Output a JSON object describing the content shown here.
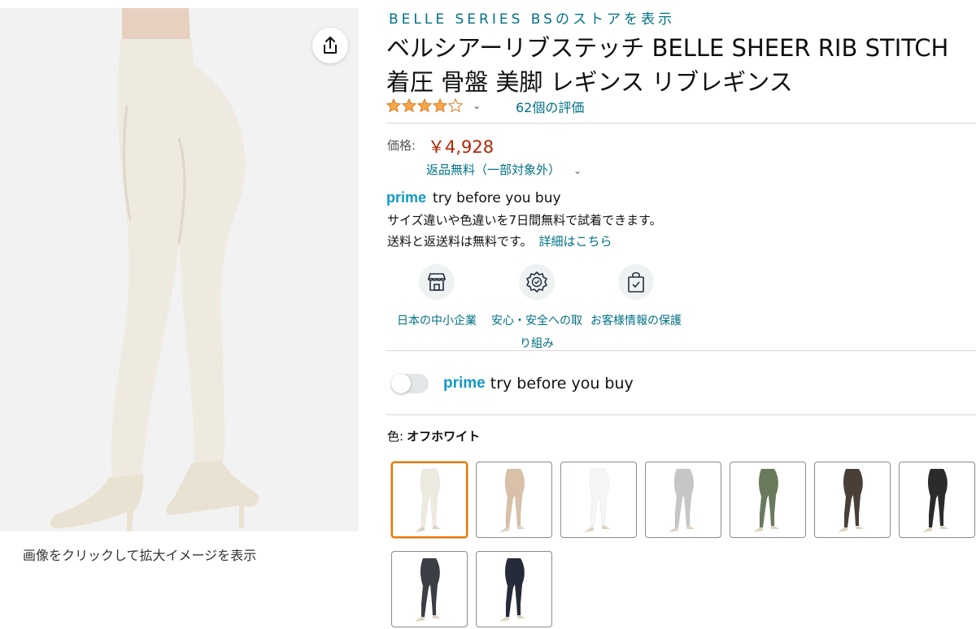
{
  "store_link": "BELLE SERIES BSのストアを表示",
  "title": "ベルシアーリブステッチ BELLE SHEER RIB STITCH 着圧 骨盤 美脚 レギンス リブレギンス",
  "rating": {
    "stars": 3.9,
    "count_text": "62個の評価"
  },
  "price": {
    "label": "価格:",
    "value": "￥4,928"
  },
  "returns": {
    "text": "返品無料（一部対象外）"
  },
  "prime": {
    "word": "prime",
    "tbyb": "try before you buy",
    "desc1": "サイズ違いや色違いを7日間無料で試着できます。",
    "desc2": "送料と返送料は無料です。",
    "more": "詳細はこちら"
  },
  "badges": [
    {
      "label": "日本の中小企業",
      "icon": "storefront-icon"
    },
    {
      "label": "安心・安全への取り組み",
      "icon": "verified-seal-icon"
    },
    {
      "label": "お客様情報の保護",
      "icon": "shopping-bag-check-icon"
    }
  ],
  "toggle": {
    "on": false,
    "word": "prime",
    "text": "try before you buy"
  },
  "color": {
    "label": "色:",
    "selected": "オフホワイト",
    "swatch_colors": [
      "#efeae0",
      "#d9c0a9",
      "#f6f6f4",
      "#c4c6c8",
      "#6a7a5c",
      "#4a3f37",
      "#2b2b2b",
      "#3b3e44",
      "#262b3a"
    ]
  },
  "image_caption": "画像をクリックして拡大イメージを表示",
  "colors": {
    "link": "#007185",
    "price": "#b12704",
    "prime": "#1399c6",
    "selected_border": "#e77600",
    "star": "#f3a847"
  }
}
